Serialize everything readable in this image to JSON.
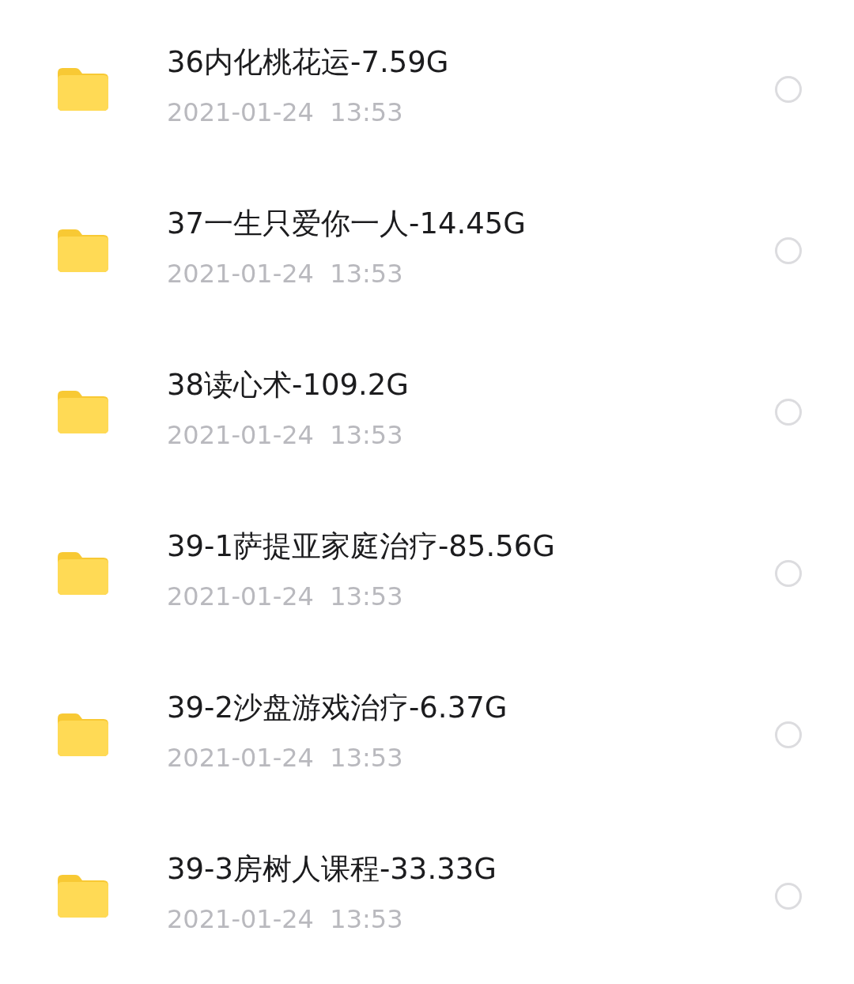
{
  "files": [
    {
      "name": "36内化桃花运-7.59G",
      "date": "2021-01-24  13:53",
      "selected": false
    },
    {
      "name": "37一生只爱你一人-14.45G",
      "date": "2021-01-24  13:53",
      "selected": false
    },
    {
      "name": "38读心术-109.2G",
      "date": "2021-01-24  13:53",
      "selected": false
    },
    {
      "name": "39-1萨提亚家庭治疗-85.56G",
      "date": "2021-01-24  13:53",
      "selected": false
    },
    {
      "name": "39-2沙盘游戏治疗-6.37G",
      "date": "2021-01-24  13:53",
      "selected": false
    },
    {
      "name": "39-3房树人课程-33.33G",
      "date": "2021-01-24  13:53",
      "selected": false
    }
  ]
}
